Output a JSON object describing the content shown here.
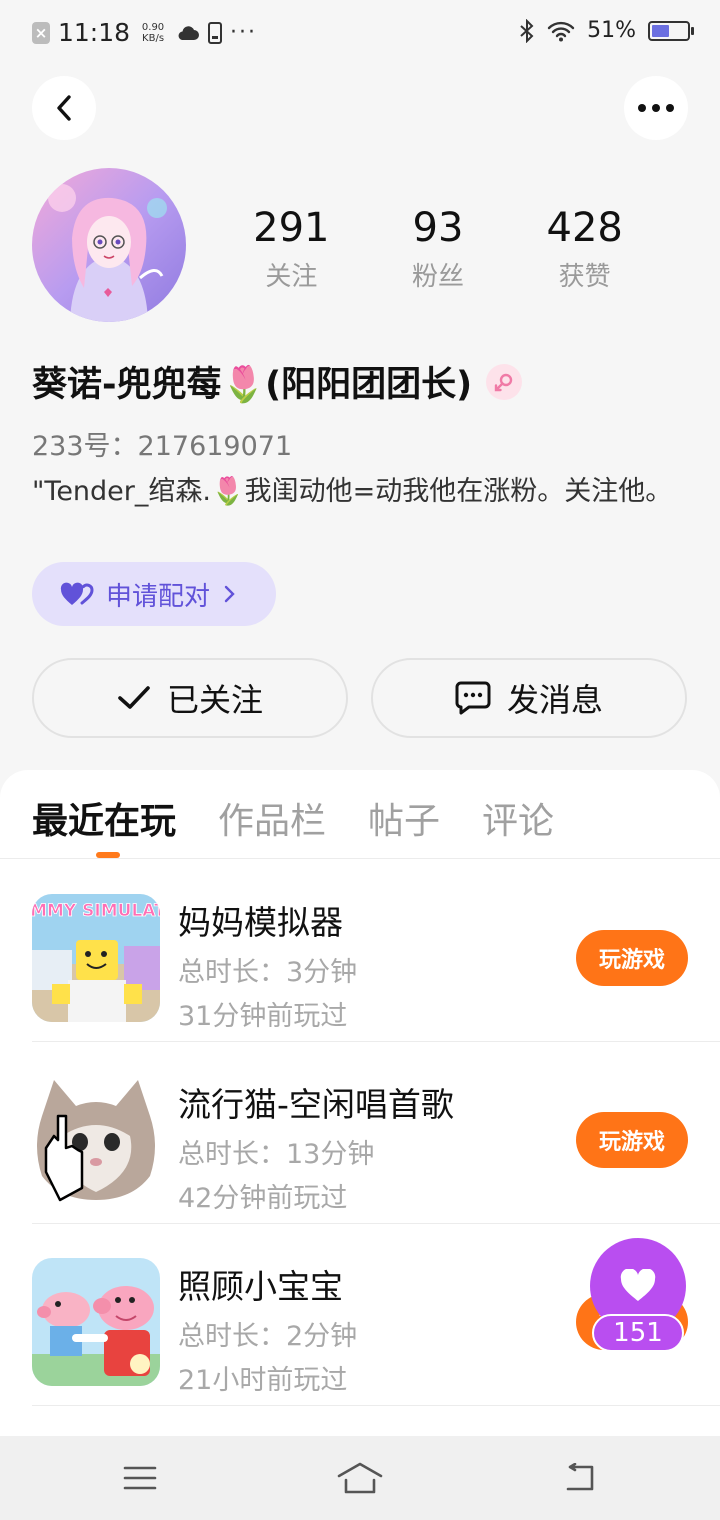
{
  "status_bar": {
    "time": "11:18",
    "net_speed_value": "0.90",
    "net_speed_unit": "KB/s",
    "more": "···",
    "battery_percent": "51%",
    "battery_level": 0.51
  },
  "profile": {
    "stats": [
      {
        "value": "291",
        "label": "关注"
      },
      {
        "value": "93",
        "label": "粉丝"
      },
      {
        "value": "428",
        "label": "获赞"
      }
    ],
    "name": "葵诺-兜兜莓🌷(阳阳团团长)",
    "uid": "233号：217619071",
    "bio": "\"Tender_绾森.🌷我闺动他=动我他在涨粉。关注他。",
    "pair_label": "申请配对"
  },
  "actions": {
    "follow_label": "已关注",
    "message_label": "发消息"
  },
  "tabs": [
    "最近在玩",
    "作品栏",
    "帖子",
    "评论"
  ],
  "games": [
    {
      "title": "妈妈模拟器",
      "duration": "总时长：3分钟",
      "last_played": "31分钟前玩过",
      "button": "玩游戏",
      "icon_text": "MOMMY SIMULATOR"
    },
    {
      "title": "流行猫-空闲唱首歌",
      "duration": "总时长：13分钟",
      "last_played": "42分钟前玩过",
      "button": "玩游戏"
    },
    {
      "title": "照顾小宝宝",
      "duration": "总时长：2分钟",
      "last_played": "21小时前玩过",
      "button": "玩游戏"
    }
  ],
  "like_float": {
    "count": "151"
  },
  "colors": {
    "accent": "#ff7417",
    "like": "#b94ef0",
    "pair_bg": "#e4e0fb",
    "pair_text": "#6152d9"
  }
}
